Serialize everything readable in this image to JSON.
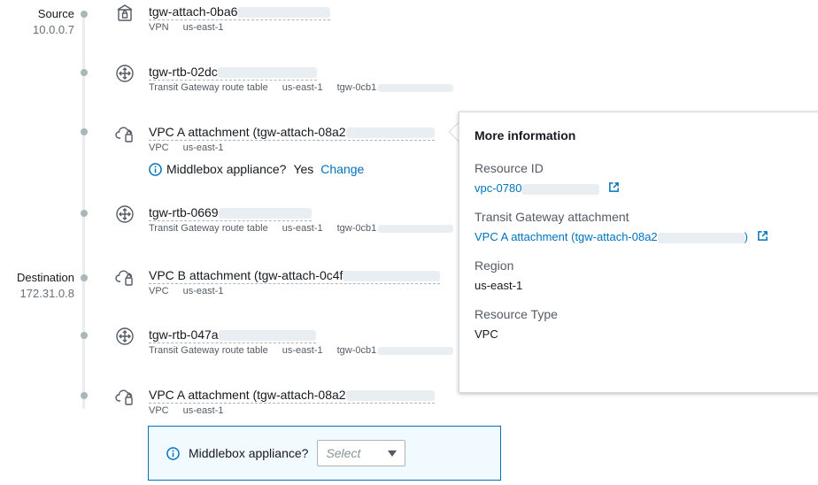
{
  "source": {
    "title": "Source",
    "ip": "10.0.0.7"
  },
  "destination": {
    "title": "Destination",
    "ip": "172.31.0.8"
  },
  "hops": [
    {
      "icon": "vpn-gateway-icon",
      "name": "tgw-attach-0ba6",
      "meta": [
        "VPN",
        "us-east-1"
      ]
    },
    {
      "icon": "route-table-icon",
      "name": "tgw-rtb-02dc",
      "meta": [
        "Transit Gateway route table",
        "us-east-1",
        "tgw-0cb1"
      ]
    },
    {
      "icon": "vpc-attachment-icon",
      "name": "VPC A attachment (tgw-attach-08a2",
      "meta": [
        "VPC",
        "us-east-1"
      ]
    },
    {
      "icon": "route-table-icon",
      "name": "tgw-rtb-0669",
      "meta": [
        "Transit Gateway route table",
        "us-east-1",
        "tgw-0cb1"
      ]
    },
    {
      "icon": "vpc-attachment-icon",
      "name": "VPC B attachment (tgw-attach-0c4f",
      "meta": [
        "VPC",
        "us-east-1"
      ]
    },
    {
      "icon": "route-table-icon",
      "name": "tgw-rtb-047a",
      "meta": [
        "Transit Gateway route table",
        "us-east-1",
        "tgw-0cb1"
      ]
    },
    {
      "icon": "vpc-attachment-icon",
      "name": "VPC A attachment (tgw-attach-08a2",
      "meta": [
        "VPC",
        "us-east-1"
      ]
    }
  ],
  "middlebox_inline": {
    "label": "Middlebox appliance?",
    "value": "Yes",
    "change": "Change"
  },
  "middlebox_box": {
    "label": "Middlebox appliance?",
    "select_placeholder": "Select"
  },
  "popover": {
    "title": "More information",
    "resource_id_label": "Resource ID",
    "resource_id_value": "vpc-0780",
    "tgw_attachment_label": "Transit Gateway attachment",
    "tgw_attachment_value": "VPC A attachment (tgw-attach-08a2",
    "tgw_attachment_suffix": ")",
    "region_label": "Region",
    "region_value": "us-east-1",
    "resource_type_label": "Resource Type",
    "resource_type_value": "VPC"
  },
  "colors": {
    "link": "#0073bb",
    "info_box_bg": "#f1faff",
    "dot": "#aab7b8"
  }
}
